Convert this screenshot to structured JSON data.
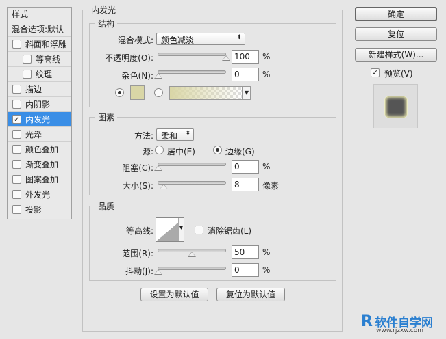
{
  "sidebar": {
    "header": "样式",
    "blend": "混合选项:默认",
    "items": [
      {
        "label": "斜面和浮雕",
        "checked": false
      },
      {
        "label": "等高线",
        "checked": false
      },
      {
        "label": "纹理",
        "checked": false
      },
      {
        "label": "描边",
        "checked": false
      },
      {
        "label": "内阴影",
        "checked": false
      },
      {
        "label": "内发光",
        "checked": true
      },
      {
        "label": "光泽",
        "checked": false
      },
      {
        "label": "颜色叠加",
        "checked": false
      },
      {
        "label": "渐变叠加",
        "checked": false
      },
      {
        "label": "图案叠加",
        "checked": false
      },
      {
        "label": "外发光",
        "checked": false
      },
      {
        "label": "投影",
        "checked": false
      }
    ]
  },
  "main": {
    "title": "内发光",
    "structure": {
      "title": "结构",
      "blend_label": "混合模式:",
      "blend_value": "颜色减淡",
      "opacity_label": "不透明度(O):",
      "opacity": "100",
      "noise_label": "杂色(N):",
      "noise": "0",
      "pct": "%",
      "color": "#d9d6a6"
    },
    "elements": {
      "title": "图素",
      "method_label": "方法:",
      "method_value": "柔和",
      "source_label": "源:",
      "center": "居中(E)",
      "edge": "边缘(G)",
      "choke_label": "阻塞(C):",
      "choke": "0",
      "size_label": "大小(S):",
      "size": "8",
      "size_unit": "像素",
      "pct": "%"
    },
    "quality": {
      "title": "品质",
      "contour_label": "等高线:",
      "antialias": "消除锯齿(L)",
      "range_label": "范围(R):",
      "range": "50",
      "jitter_label": "抖动(J):",
      "jitter": "0",
      "pct": "%"
    },
    "default_btn": "设置为默认值",
    "reset_default_btn": "复位为默认值"
  },
  "right": {
    "ok": "确定",
    "reset": "复位",
    "new_style": "新建样式(W)...",
    "preview": "预览(V)"
  },
  "watermark": {
    "brand": "软件自学网",
    "url": "www.rjzxw.com"
  }
}
